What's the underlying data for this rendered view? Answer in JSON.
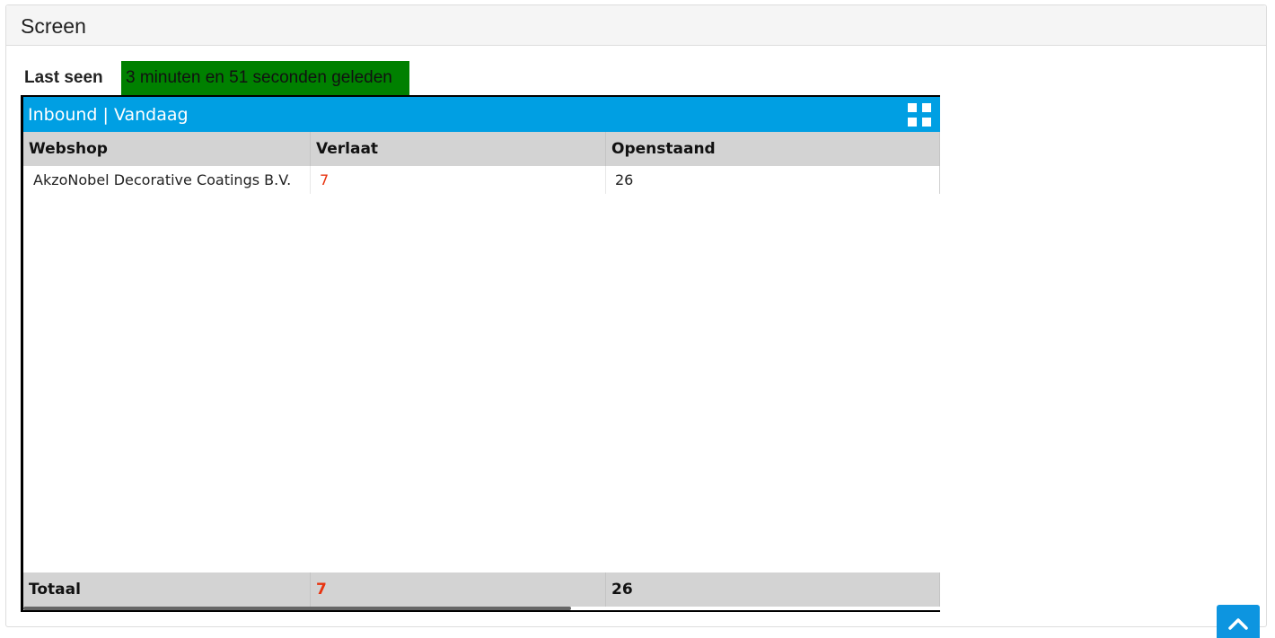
{
  "panel": {
    "title": "Screen"
  },
  "last_seen": {
    "label": "Last seen",
    "value": "3 minuten en 51 seconden geleden",
    "status_color": "#008000"
  },
  "widget": {
    "title": "Inbound | Vandaag",
    "header_color": "#009fe3",
    "icon": "grid-icon",
    "columns": [
      "Webshop",
      "Verlaat",
      "Openstaand"
    ],
    "rows": [
      [
        "AkzoNobel Decorative Coatings B.V.",
        "7",
        "26"
      ]
    ],
    "footer": [
      "Totaal",
      "7",
      "26"
    ],
    "late_color": "#e8330f"
  },
  "scroll_top": {
    "icon": "chevron-up-icon",
    "color": "#0d95e0"
  }
}
